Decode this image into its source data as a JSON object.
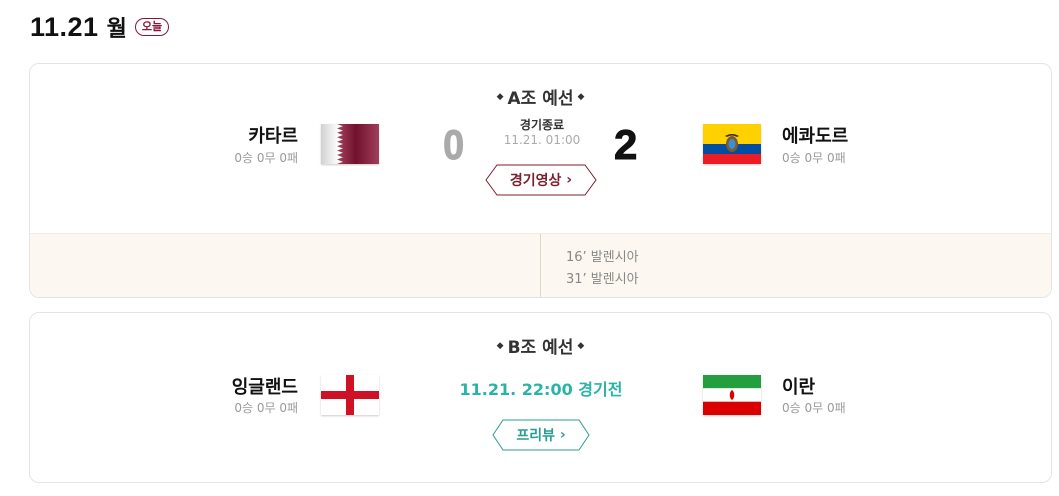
{
  "header": {
    "date": "11.21",
    "weekday": "월",
    "today_badge": "오늘"
  },
  "matches": [
    {
      "group": "A조 예선",
      "home": {
        "name": "카타르",
        "record": "0승 0무 0패",
        "flag": "qatar-flag"
      },
      "away": {
        "name": "에콰도르",
        "record": "0승 0무 0패",
        "flag": "ecuador-flag"
      },
      "home_score": "0",
      "away_score": "2",
      "status": "경기종료",
      "time": "11.21. 01:00",
      "button_label": "경기영상",
      "goals": [
        {
          "text": "16’ 발렌시아"
        },
        {
          "text": "31’ 발렌시아"
        }
      ]
    },
    {
      "group": "B조 예선",
      "home": {
        "name": "잉글랜드",
        "record": "0승 0무 0패",
        "flag": "england-flag"
      },
      "away": {
        "name": "이란",
        "record": "0승 0무 0패",
        "flag": "iran-flag"
      },
      "kickoff": "11.21. 22:00 경기전",
      "button_label": "프리뷰"
    }
  ],
  "colors": {
    "video_button": "#7a1f2e",
    "preview_button": "#2a9d8f",
    "kickoff_text": "#2ab3a6",
    "goal_strip_bg": "#fcf8f1",
    "today_badge": "#8a1538"
  },
  "icons": {
    "group_marker": "diamond-icon",
    "button_arrow": "chevron-right-icon"
  }
}
